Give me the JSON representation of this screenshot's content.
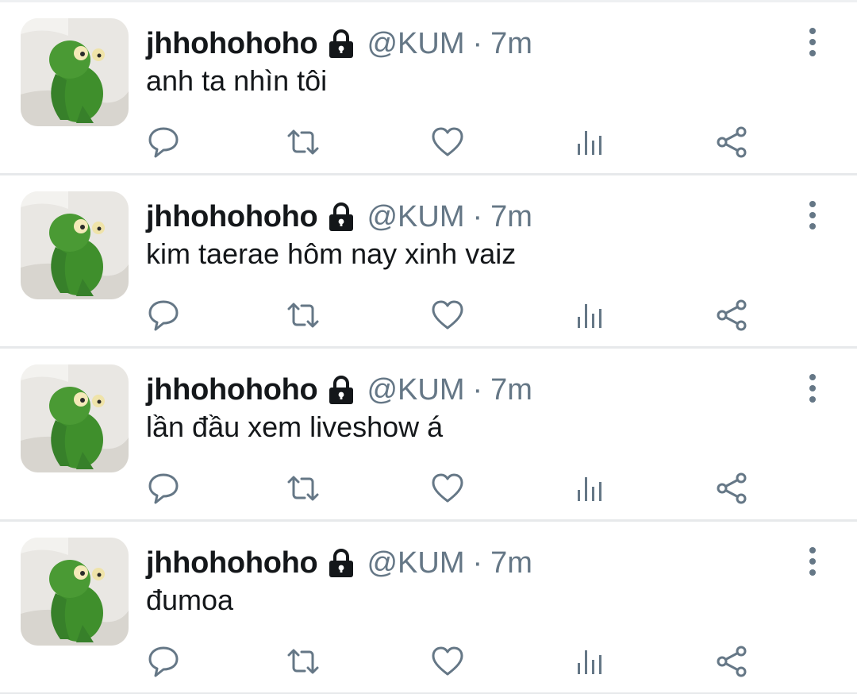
{
  "tweets": [
    {
      "name": "jhhohohoho",
      "handle": "@KUM",
      "separator": "·",
      "time": "7m",
      "text": "anh ta nhìn tôi"
    },
    {
      "name": "jhhohohoho",
      "handle": "@KUM",
      "separator": "·",
      "time": "7m",
      "text": "kim taerae hôm nay xinh vaiz"
    },
    {
      "name": "jhhohohoho",
      "handle": "@KUM",
      "separator": "·",
      "time": "7m",
      "text": "lần đầu xem liveshow á"
    },
    {
      "name": "jhhohohoho",
      "handle": "@KUM",
      "separator": "·",
      "time": "7m",
      "text": "đumoa"
    }
  ],
  "colors": {
    "text_primary": "#14171a",
    "text_secondary": "#657786",
    "icon": "#657786",
    "divider": "#e7e9eb",
    "avatar_green": "#3f8f2c"
  },
  "icons": {
    "lock": "lock-icon",
    "more": "more-vertical-icon",
    "reply": "reply-icon",
    "retweet": "retweet-icon",
    "like": "heart-icon",
    "analytics": "analytics-icon",
    "share": "share-icon"
  }
}
